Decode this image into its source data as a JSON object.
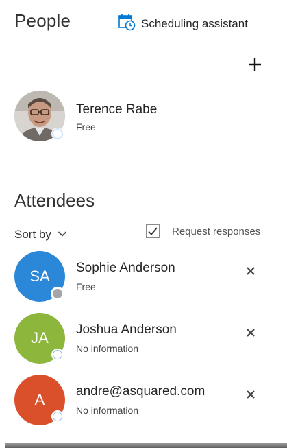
{
  "people": {
    "title": "People",
    "scheduling_assistant_label": "Scheduling assistant",
    "search": {
      "value": "",
      "placeholder": ""
    },
    "add_icon": "plus-icon",
    "organizer": {
      "name": "Terence Rabe",
      "status": "Free",
      "presence": "available"
    }
  },
  "attendees": {
    "title": "Attendees",
    "sort_label": "Sort by",
    "request_responses_label": "Request responses",
    "request_responses_checked": true,
    "list": [
      {
        "initials": "SA",
        "name": "Sophie Anderson",
        "status": "Free",
        "color": "#2b88d8",
        "presence": "unknown"
      },
      {
        "initials": "JA",
        "name": "Joshua Anderson",
        "status": "No information",
        "color": "#8cb63c",
        "presence": "none"
      },
      {
        "initials": "A",
        "name": "andre@asquared.com",
        "status": "No information",
        "color": "#d9502a",
        "presence": "none"
      }
    ]
  },
  "colors": {
    "accent": "#0078d4",
    "presence_unknown": "#a6a6a6"
  }
}
